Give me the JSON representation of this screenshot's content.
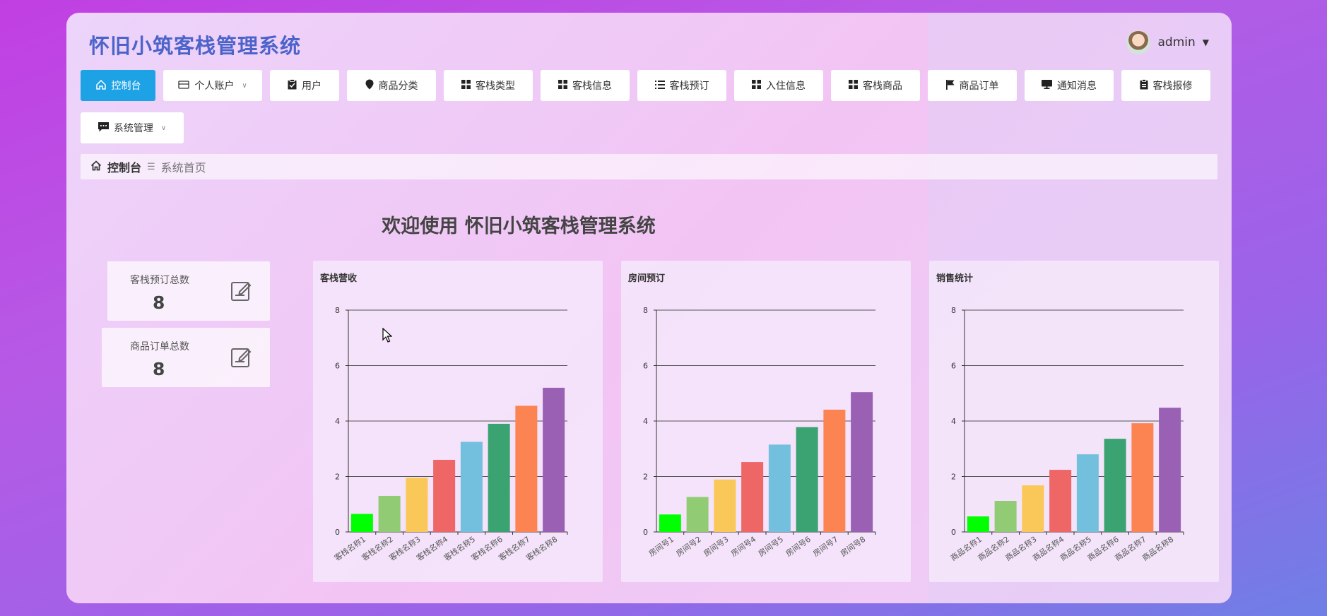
{
  "app": {
    "title": "怀旧小筑客栈管理系统"
  },
  "user": {
    "name": "admin"
  },
  "nav": [
    {
      "label": "控制台",
      "icon": "home-icon",
      "active": true
    },
    {
      "label": "个人账户",
      "icon": "wallet-icon",
      "dropdown": true
    },
    {
      "label": "用户",
      "icon": "clipboard-check-icon"
    },
    {
      "label": "商品分类",
      "icon": "pin-icon"
    },
    {
      "label": "客栈类型",
      "icon": "grid-icon"
    },
    {
      "label": "客栈信息",
      "icon": "grid-icon"
    },
    {
      "label": "客栈预订",
      "icon": "list-icon"
    },
    {
      "label": "入住信息",
      "icon": "grid-icon"
    },
    {
      "label": "客栈商品",
      "icon": "grid-icon"
    },
    {
      "label": "商品订单",
      "icon": "flag-icon"
    },
    {
      "label": "通知消息",
      "icon": "monitor-icon"
    },
    {
      "label": "客栈报修",
      "icon": "clipboard-icon"
    },
    {
      "label": "系统管理",
      "icon": "chat-icon",
      "dropdown": true
    }
  ],
  "breadcrumb": {
    "home": "控制台",
    "current": "系统首页"
  },
  "welcome": "欢迎使用 怀旧小筑客栈管理系统",
  "stats": [
    {
      "label": "客栈预订总数",
      "value": "8"
    },
    {
      "label": "商品订单总数",
      "value": "8"
    }
  ],
  "colors": [
    "#00ff00",
    "#91cc75",
    "#fac858",
    "#ee6666",
    "#73c0de",
    "#3ba272",
    "#fc8452",
    "#9a60b4"
  ],
  "chart_data": [
    {
      "type": "bar",
      "title": "客栈营收",
      "categories": [
        "客栈名称1",
        "客栈名称2",
        "客栈名称3",
        "客栈名称4",
        "客栈名称5",
        "客栈名称6",
        "客栈名称7",
        "客栈名称8"
      ],
      "values": [
        0.65,
        1.3,
        1.95,
        2.6,
        3.25,
        3.9,
        4.55,
        5.2
      ],
      "ylim": [
        0,
        8
      ],
      "yticks": [
        0,
        2,
        4,
        6,
        8
      ],
      "grid": true
    },
    {
      "type": "bar",
      "title": "房间预订",
      "categories": [
        "房间号1",
        "房间号2",
        "房间号3",
        "房间号4",
        "房间号5",
        "房间号6",
        "房间号7",
        "房间号8"
      ],
      "values": [
        0.63,
        1.26,
        1.89,
        2.52,
        3.15,
        3.78,
        4.41,
        5.04
      ],
      "ylim": [
        0,
        8
      ],
      "yticks": [
        0,
        2,
        4,
        6,
        8
      ],
      "grid": true
    },
    {
      "type": "bar",
      "title": "销售统计",
      "categories": [
        "商品名称1",
        "商品名称2",
        "商品名称3",
        "商品名称4",
        "商品名称5",
        "商品名称6",
        "商品名称7",
        "商品名称8"
      ],
      "values": [
        0.56,
        1.12,
        1.68,
        2.24,
        2.8,
        3.36,
        3.92,
        4.48
      ],
      "ylim": [
        0,
        8
      ],
      "yticks": [
        0,
        2,
        4,
        6,
        8
      ],
      "grid": true
    }
  ]
}
